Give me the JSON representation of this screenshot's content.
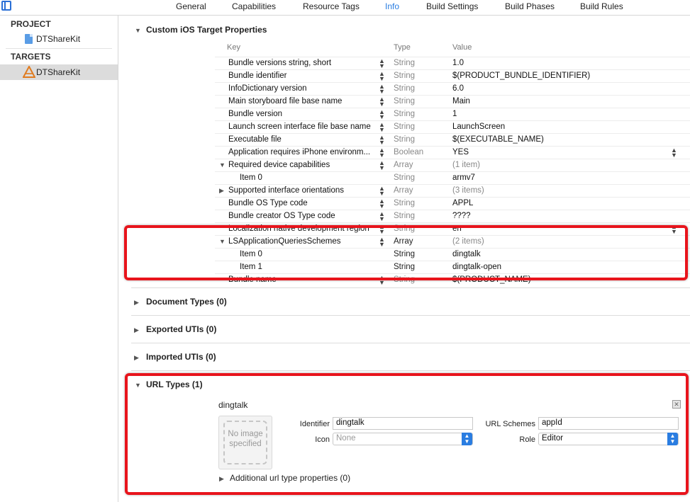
{
  "tabs": [
    "General",
    "Capabilities",
    "Resource Tags",
    "Info",
    "Build Settings",
    "Build Phases",
    "Build Rules"
  ],
  "active_tab": "Info",
  "sidebar": {
    "project_header": "PROJECT",
    "project_item": "DTShareKit",
    "targets_header": "TARGETS",
    "target_item": "DTShareKit"
  },
  "custom_props": {
    "title": "Custom iOS Target Properties",
    "col_key": "Key",
    "col_type": "Type",
    "col_value": "Value",
    "rows": [
      {
        "key": "Bundle versions string, short",
        "type": "String",
        "value": "1.0"
      },
      {
        "key": "Bundle identifier",
        "type": "String",
        "value": "$(PRODUCT_BUNDLE_IDENTIFIER)"
      },
      {
        "key": "InfoDictionary version",
        "type": "String",
        "value": "6.0"
      },
      {
        "key": "Main storyboard file base name",
        "type": "String",
        "value": "Main"
      },
      {
        "key": "Bundle version",
        "type": "String",
        "value": "1"
      },
      {
        "key": "Launch screen interface file base name",
        "type": "String",
        "value": "LaunchScreen"
      },
      {
        "key": "Executable file",
        "type": "String",
        "value": "$(EXECUTABLE_NAME)"
      },
      {
        "key": "Application requires iPhone environm...",
        "type": "Boolean",
        "value": "YES"
      },
      {
        "key": "Required device capabilities",
        "type": "Array",
        "value": "(1 item)"
      },
      {
        "key": "Item 0",
        "type": "String",
        "value": "armv7"
      },
      {
        "key": "Supported interface orientations",
        "type": "Array",
        "value": "(3 items)"
      },
      {
        "key": "Bundle OS Type code",
        "type": "String",
        "value": "APPL"
      },
      {
        "key": "Bundle creator OS Type code",
        "type": "String",
        "value": "????"
      },
      {
        "key": "Localization native development region",
        "type": "String",
        "value": "en"
      },
      {
        "key": "LSApplicationQueriesSchemes",
        "type": "Array",
        "value": "(2 items)"
      },
      {
        "key": "Item 0",
        "type": "String",
        "value": "dingtalk"
      },
      {
        "key": "Item 1",
        "type": "String",
        "value": "dingtalk-open"
      },
      {
        "key": "Bundle name",
        "type": "String",
        "value": "$(PRODUCT_NAME)"
      }
    ]
  },
  "sections": {
    "document_types": "Document Types (0)",
    "exported_utis": "Exported UTIs (0)",
    "imported_utis": "Imported UTIs (0)",
    "url_types": "URL Types (1)"
  },
  "url_type": {
    "name": "dingtalk",
    "image_placeholder": "No image specified",
    "identifier_label": "Identifier",
    "identifier_value": "dingtalk",
    "icon_label": "Icon",
    "icon_placeholder": "None",
    "url_schemes_label": "URL Schemes",
    "url_schemes_value": "appId",
    "role_label": "Role",
    "role_value": "Editor",
    "additional": "Additional url type properties (0)"
  },
  "colors": {
    "accent": "#2a7de1",
    "highlight_frame": "#e8141c"
  }
}
